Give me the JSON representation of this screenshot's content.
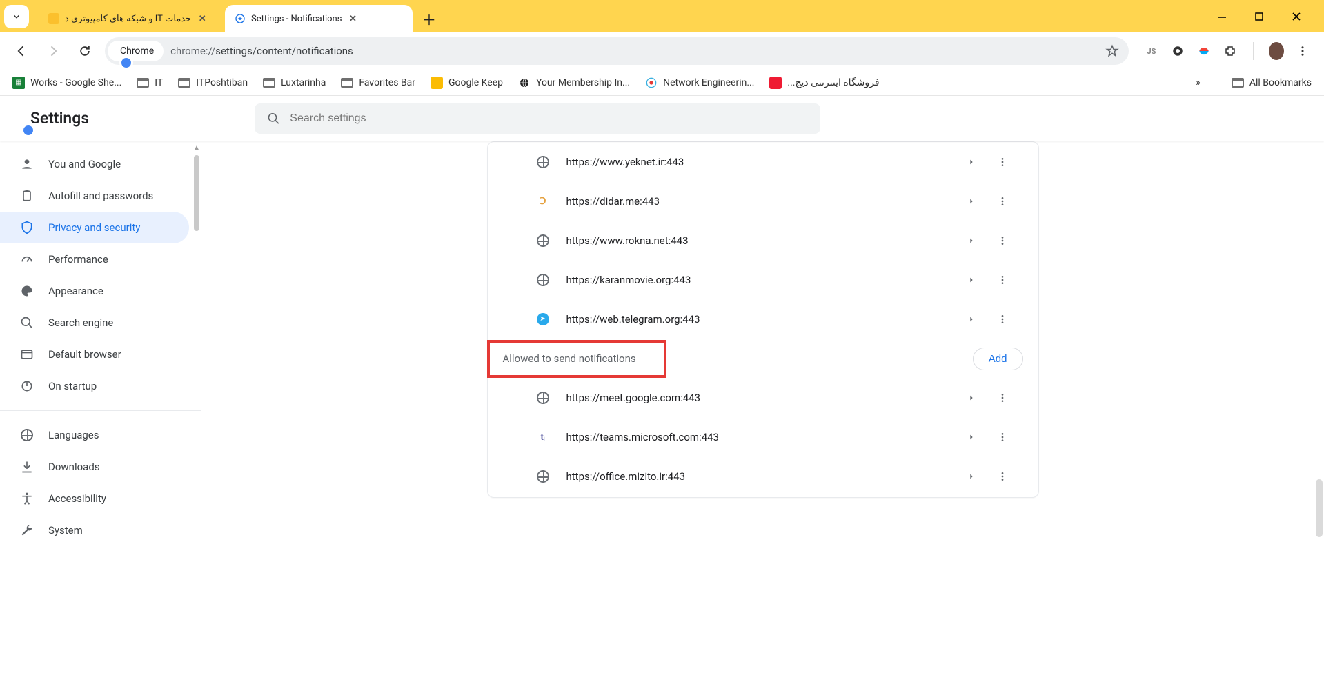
{
  "window": {
    "tabs": [
      {
        "title": "خدمات IT و شبکه های کامپیوتری د",
        "active": false
      },
      {
        "title": "Settings - Notifications",
        "active": true
      }
    ]
  },
  "omnibox": {
    "site_label": "Chrome",
    "url_prefix": "chrome://",
    "url_path": "settings/content/notifications"
  },
  "bookmarks": [
    {
      "label": "Works - Google She...",
      "icon": "sheets"
    },
    {
      "label": "IT",
      "icon": "folder"
    },
    {
      "label": "ITPoshtiban",
      "icon": "folder"
    },
    {
      "label": "Luxtarinha",
      "icon": "folder"
    },
    {
      "label": "Favorites Bar",
      "icon": "folder"
    },
    {
      "label": "Google Keep",
      "icon": "keep"
    },
    {
      "label": "Your Membership In...",
      "icon": "globe-dark"
    },
    {
      "label": "Network Engineerin...",
      "icon": "ne"
    },
    {
      "label": "فروشگاه اینترنتی دیج...",
      "icon": "digi"
    }
  ],
  "bookmarks_more": "»",
  "all_bookmarks_label": "All Bookmarks",
  "settings_header": {
    "title": "Settings",
    "search_placeholder": "Search settings"
  },
  "sidebar": {
    "items": [
      {
        "label": "You and Google",
        "icon": "person"
      },
      {
        "label": "Autofill and passwords",
        "icon": "clipboard"
      },
      {
        "label": "Privacy and security",
        "icon": "shield",
        "active": true
      },
      {
        "label": "Performance",
        "icon": "speed"
      },
      {
        "label": "Appearance",
        "icon": "palette"
      },
      {
        "label": "Search engine",
        "icon": "search"
      },
      {
        "label": "Default browser",
        "icon": "window"
      },
      {
        "label": "On startup",
        "icon": "power"
      }
    ],
    "items2": [
      {
        "label": "Languages",
        "icon": "globe"
      },
      {
        "label": "Downloads",
        "icon": "download"
      },
      {
        "label": "Accessibility",
        "icon": "accessibility"
      },
      {
        "label": "System",
        "icon": "wrench"
      }
    ]
  },
  "content": {
    "blocked_sites": [
      {
        "url": "https://www.yeknet.ir:443",
        "fav": "globe"
      },
      {
        "url": "https://didar.me:443",
        "fav": "didar"
      },
      {
        "url": "https://www.rokna.net:443",
        "fav": "globe"
      },
      {
        "url": "https://karanmovie.org:443",
        "fav": "globe"
      },
      {
        "url": "https://web.telegram.org:443",
        "fav": "telegram"
      }
    ],
    "allowed_header": "Allowed to send notifications",
    "add_label": "Add",
    "allowed_sites": [
      {
        "url": "https://meet.google.com:443",
        "fav": "globe"
      },
      {
        "url": "https://teams.microsoft.com:443",
        "fav": "teams"
      },
      {
        "url": "https://office.mizito.ir:443",
        "fav": "globe"
      }
    ]
  }
}
